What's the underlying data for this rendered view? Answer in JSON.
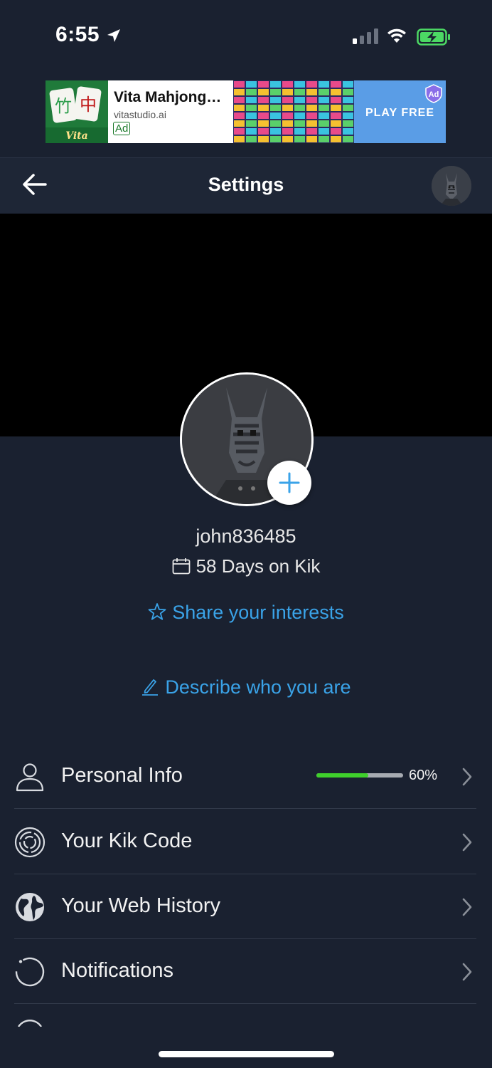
{
  "status_bar": {
    "time": "6:55",
    "icons": [
      "location-arrow-icon",
      "signal-icon",
      "wifi-icon",
      "battery-charging-icon"
    ]
  },
  "ad": {
    "title": "Vita Mahjong…",
    "domain": "vitastudio.ai",
    "badge": "Ad",
    "cta": "PLAY FREE",
    "app_icon_text": "Vita"
  },
  "header": {
    "title": "Settings"
  },
  "profile": {
    "username": "john836485",
    "days_on_kik": "58 Days on Kik",
    "share_interests": "Share your interests",
    "describe": "Describe who you are"
  },
  "settings": {
    "items": [
      {
        "label": "Personal Info",
        "icon": "person-icon",
        "progress": 0.6,
        "progress_label": "60%"
      },
      {
        "label": "Your Kik Code",
        "icon": "kik-code-icon"
      },
      {
        "label": "Your Web History",
        "icon": "globe-icon"
      },
      {
        "label": "Notifications",
        "icon": "notification-ring-icon"
      }
    ]
  },
  "colors": {
    "background": "#1a2130",
    "header": "#1e2636",
    "link": "#3aa3e8",
    "progress": "#3fd02c",
    "battery": "#4cd964"
  }
}
